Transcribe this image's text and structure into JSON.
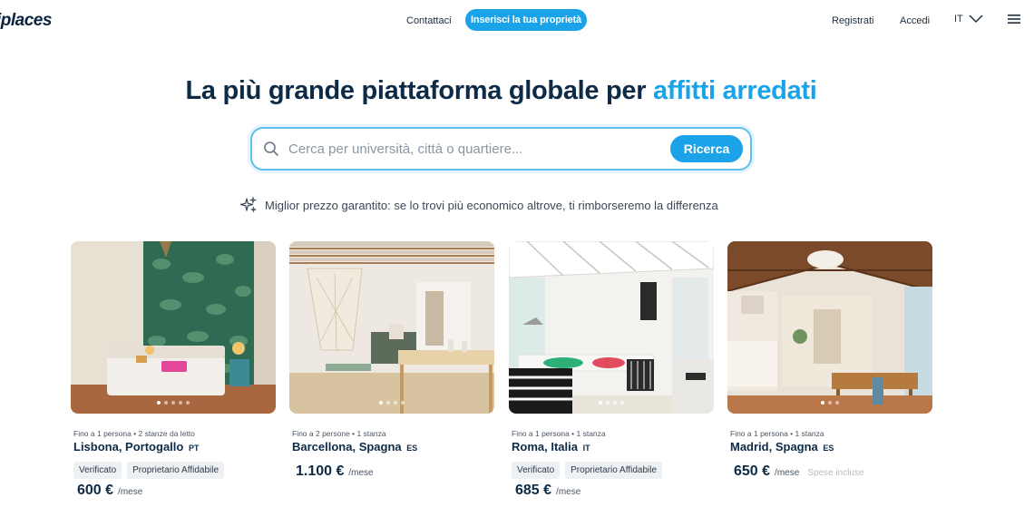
{
  "header": {
    "logo": "uniplaces",
    "contact": "Contattaci",
    "cta": "Inserisci la tua proprietà",
    "register": "Registrati",
    "login": "Accedi",
    "language": "IT",
    "icons": [
      "chevron-down-icon",
      "hamburger-menu-icon"
    ]
  },
  "hero": {
    "title_main": "La più grande piattaforma globale per ",
    "title_accent": "affitti arredati",
    "accent_color": "#1aa3e8"
  },
  "search": {
    "placeholder": "Cerca per università, città o quartiere...",
    "button": "Ricerca"
  },
  "guarantee": {
    "text": "Miglior prezzo garantito: se lo trovi più economico altrove, ti rimborseremo la differenza"
  },
  "listings": [
    {
      "meta": "Fino a 1 persona • 2 stanze da letto",
      "city": "Lisbona, Portogallo",
      "country_code": "PT",
      "badges": [
        "Verificato",
        "Proprietario Affidabile"
      ],
      "price": "600 €",
      "period": "/mese",
      "extra": ""
    },
    {
      "meta": "Fino a 2 persone • 1 stanza",
      "city": "Barcellona, Spagna",
      "country_code": "ES",
      "badges": [],
      "price": "1.100 €",
      "period": "/mese",
      "extra": ""
    },
    {
      "meta": "Fino a 1 persona • 1 stanza",
      "city": "Roma, Italia",
      "country_code": "IT",
      "badges": [
        "Verificato",
        "Proprietario Affidabile"
      ],
      "price": "685 €",
      "period": "/mese",
      "extra": ""
    },
    {
      "meta": "Fino a 1 persona • 1 stanza",
      "city": "Madrid, Spagna",
      "country_code": "ES",
      "badges": [],
      "price": "650 €",
      "period": "/mese",
      "extra": "Spese incluse"
    }
  ]
}
